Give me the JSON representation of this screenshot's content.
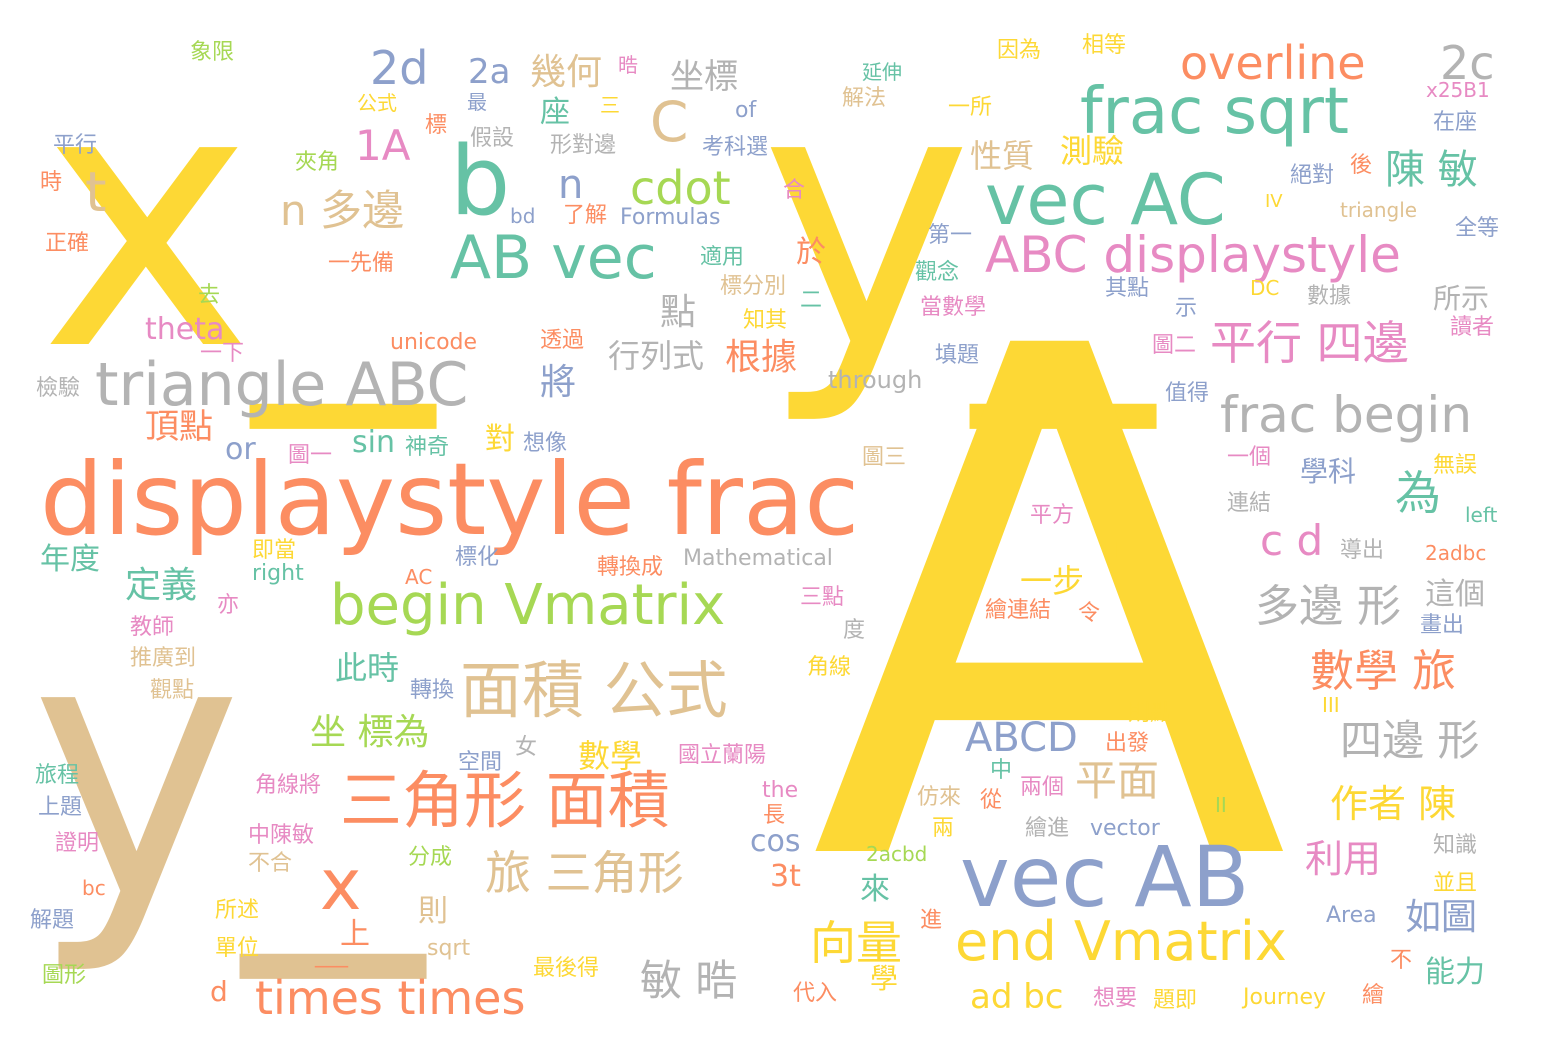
{
  "palette": {
    "yellow": "#fdd835",
    "tan": "#e0c292",
    "green": "#66c2a5",
    "orange": "#fc8d62",
    "blue": "#8da0cb",
    "pink": "#e78ac3",
    "lime": "#a6d854",
    "gray": "#b3b3b3"
  },
  "words": [
    {
      "text": "x_",
      "color": "yellow"
    },
    {
      "text": "y_",
      "color": "yellow"
    },
    {
      "text": "y_",
      "color": "tan"
    },
    {
      "text": "A",
      "color": "yellow"
    },
    {
      "text": "displaystyle frac",
      "color": "orange"
    },
    {
      "text": "vec AB",
      "color": "blue"
    },
    {
      "text": "vec AC",
      "color": "green"
    },
    {
      "text": "frac sqrt",
      "color": "green"
    },
    {
      "text": "AB vec",
      "color": "green"
    },
    {
      "text": "triangle ABC",
      "color": "gray"
    },
    {
      "text": "begin Vmatrix",
      "color": "lime"
    },
    {
      "text": "三角形 面積",
      "color": "orange"
    },
    {
      "text": "面積 公式",
      "color": "tan"
    },
    {
      "text": "end Vmatrix",
      "color": "yellow"
    },
    {
      "text": "ABC displaystyle",
      "color": "pink"
    },
    {
      "text": "frac begin",
      "color": "gray"
    },
    {
      "text": "b",
      "color": "green"
    },
    {
      "text": "x",
      "color": "orange"
    },
    {
      "text": "t",
      "color": "tan"
    },
    {
      "text": "C",
      "color": "tan"
    },
    {
      "text": "overline",
      "color": "orange"
    },
    {
      "text": "2c",
      "color": "gray"
    },
    {
      "text": "2d",
      "color": "blue"
    },
    {
      "text": "2a",
      "color": "blue"
    },
    {
      "text": "幾何",
      "color": "tan"
    },
    {
      "text": "坐標",
      "color": "gray"
    },
    {
      "text": "1A",
      "color": "pink"
    },
    {
      "text": "n",
      "color": "blue"
    },
    {
      "text": "n 多邊",
      "color": "tan"
    },
    {
      "text": "cdot",
      "color": "lime"
    },
    {
      "text": "times times",
      "color": "orange"
    },
    {
      "text": "平行 四邊",
      "color": "pink"
    },
    {
      "text": "陳 敏",
      "color": "green"
    },
    {
      "text": "性質",
      "color": "tan"
    },
    {
      "text": "測驗",
      "color": "yellow"
    },
    {
      "text": "多邊 形",
      "color": "gray"
    },
    {
      "text": "四邊 形",
      "color": "gray"
    },
    {
      "text": "數學 旅",
      "color": "orange"
    },
    {
      "text": "c d",
      "color": "pink"
    },
    {
      "text": "為",
      "color": "green"
    },
    {
      "text": "ABCD",
      "color": "blue"
    },
    {
      "text": "平面",
      "color": "tan"
    },
    {
      "text": "作者 陳",
      "color": "yellow"
    },
    {
      "text": "利用",
      "color": "pink"
    },
    {
      "text": "如圖",
      "color": "blue"
    },
    {
      "text": "能力",
      "color": "green"
    },
    {
      "text": "旅 三角形",
      "color": "tan"
    },
    {
      "text": "向量",
      "color": "yellow"
    },
    {
      "text": "敏 晧",
      "color": "gray"
    },
    {
      "text": "ad bc",
      "color": "yellow"
    },
    {
      "text": "坐 標為",
      "color": "lime"
    },
    {
      "text": "定義",
      "color": "green"
    },
    {
      "text": "此時",
      "color": "green"
    },
    {
      "text": "數學",
      "color": "yellow"
    },
    {
      "text": "根據",
      "color": "orange"
    },
    {
      "text": "將",
      "color": "blue"
    },
    {
      "text": "點",
      "color": "gray"
    },
    {
      "text": "行列式",
      "color": "gray"
    },
    {
      "text": "theta",
      "color": "pink"
    },
    {
      "text": "sin",
      "color": "green"
    },
    {
      "text": "or",
      "color": "blue"
    },
    {
      "text": "頂點",
      "color": "orange"
    },
    {
      "text": "年度",
      "color": "green"
    },
    {
      "text": "一步",
      "color": "yellow"
    },
    {
      "text": "cos",
      "color": "blue"
    },
    {
      "text": "3t",
      "color": "orange"
    },
    {
      "text": "來",
      "color": "green"
    },
    {
      "text": "則",
      "color": "tan"
    },
    {
      "text": "上",
      "color": "orange"
    },
    {
      "text": "d",
      "color": "orange"
    },
    {
      "text": "對",
      "color": "yellow"
    },
    {
      "text": "座",
      "color": "green"
    },
    {
      "text": "於",
      "color": "orange"
    },
    {
      "text": "這個",
      "color": "gray"
    },
    {
      "text": "學科",
      "color": "blue"
    },
    {
      "text": "所示",
      "color": "gray"
    },
    {
      "text": "through",
      "color": "gray"
    },
    {
      "text": "unicode",
      "color": "orange"
    },
    {
      "text": "Formulas",
      "color": "blue"
    },
    {
      "text": "Mathematical",
      "color": "gray"
    },
    {
      "text": "vector",
      "color": "blue"
    },
    {
      "text": "Area",
      "color": "blue"
    },
    {
      "text": "Journey",
      "color": "yellow"
    },
    {
      "text": "triangle",
      "color": "tan"
    },
    {
      "text": "2acbd",
      "color": "lime"
    },
    {
      "text": "2adbc",
      "color": "orange"
    },
    {
      "text": "left",
      "color": "green"
    },
    {
      "text": "right",
      "color": "green"
    },
    {
      "text": "x25B1",
      "color": "pink"
    },
    {
      "text": "of",
      "color": "blue"
    },
    {
      "text": "the",
      "color": "pink"
    },
    {
      "text": "bd",
      "color": "blue"
    },
    {
      "text": "bc",
      "color": "orange"
    },
    {
      "text": "AC",
      "color": "orange"
    },
    {
      "text": "DC",
      "color": "yellow"
    },
    {
      "text": "象限",
      "color": "lime"
    },
    {
      "text": "晧",
      "color": "pink"
    },
    {
      "text": "延伸",
      "color": "green"
    },
    {
      "text": "因為",
      "color": "yellow"
    },
    {
      "text": "相等",
      "color": "yellow"
    },
    {
      "text": "解法",
      "color": "tan"
    },
    {
      "text": "公式",
      "color": "yellow"
    },
    {
      "text": "最",
      "color": "blue"
    },
    {
      "text": "三",
      "color": "yellow"
    },
    {
      "text": "平行",
      "color": "blue"
    },
    {
      "text": "標",
      "color": "orange"
    },
    {
      "text": "假設",
      "color": "gray"
    },
    {
      "text": "形對邊",
      "color": "gray"
    },
    {
      "text": "考科選",
      "color": "blue"
    },
    {
      "text": "一所",
      "color": "yellow"
    },
    {
      "text": "在座",
      "color": "blue"
    },
    {
      "text": "夾角",
      "color": "lime"
    },
    {
      "text": "時",
      "color": "orange"
    },
    {
      "text": "絕對",
      "color": "blue"
    },
    {
      "text": "後",
      "color": "orange"
    },
    {
      "text": "合",
      "color": "pink"
    },
    {
      "text": "了解",
      "color": "orange"
    },
    {
      "text": "第一",
      "color": "blue"
    },
    {
      "text": "全等",
      "color": "blue"
    },
    {
      "text": "正確",
      "color": "orange"
    },
    {
      "text": "一先備",
      "color": "orange"
    },
    {
      "text": "適用",
      "color": "green"
    },
    {
      "text": "觀念",
      "color": "green"
    },
    {
      "text": "其點",
      "color": "blue"
    },
    {
      "text": "數據",
      "color": "gray"
    },
    {
      "text": "去",
      "color": "lime"
    },
    {
      "text": "標分別",
      "color": "tan"
    },
    {
      "text": "二",
      "color": "green"
    },
    {
      "text": "當數學",
      "color": "pink"
    },
    {
      "text": "示",
      "color": "blue"
    },
    {
      "text": "知其",
      "color": "yellow"
    },
    {
      "text": "讀者",
      "color": "pink"
    },
    {
      "text": "一下",
      "color": "pink"
    },
    {
      "text": "透過",
      "color": "orange"
    },
    {
      "text": "填題",
      "color": "blue"
    },
    {
      "text": "圖二",
      "color": "pink"
    },
    {
      "text": "檢驗",
      "color": "gray"
    },
    {
      "text": "值得",
      "color": "blue"
    },
    {
      "text": "神奇",
      "color": "green"
    },
    {
      "text": "想像",
      "color": "blue"
    },
    {
      "text": "圖一",
      "color": "pink"
    },
    {
      "text": "圖三",
      "color": "tan"
    },
    {
      "text": "一個",
      "color": "pink"
    },
    {
      "text": "無誤",
      "color": "yellow"
    },
    {
      "text": "平方",
      "color": "pink"
    },
    {
      "text": "連結",
      "color": "gray"
    },
    {
      "text": "即當",
      "color": "yellow"
    },
    {
      "text": "標化",
      "color": "blue"
    },
    {
      "text": "轉換成",
      "color": "orange"
    },
    {
      "text": "導出",
      "color": "gray"
    },
    {
      "text": "三點",
      "color": "pink"
    },
    {
      "text": "度",
      "color": "gray"
    },
    {
      "text": "亦",
      "color": "pink"
    },
    {
      "text": "教師",
      "color": "pink"
    },
    {
      "text": "繪連結",
      "color": "orange"
    },
    {
      "text": "令",
      "color": "orange"
    },
    {
      "text": "畫出",
      "color": "blue"
    },
    {
      "text": "推廣到",
      "color": "tan"
    },
    {
      "text": "觀點",
      "color": "tan"
    },
    {
      "text": "轉換",
      "color": "blue"
    },
    {
      "text": "角線",
      "color": "yellow"
    },
    {
      "text": "III",
      "color": "yellow"
    },
    {
      "text": "則點",
      "color": "yellow"
    },
    {
      "text": "女",
      "color": "gray"
    },
    {
      "text": "空間",
      "color": "blue"
    },
    {
      "text": "國立蘭陽",
      "color": "pink"
    },
    {
      "text": "出發",
      "color": "orange"
    },
    {
      "text": "旅程",
      "color": "green"
    },
    {
      "text": "中",
      "color": "green"
    },
    {
      "text": "角線將",
      "color": "pink"
    },
    {
      "text": "上題",
      "color": "blue"
    },
    {
      "text": "從",
      "color": "orange"
    },
    {
      "text": "兩個",
      "color": "pink"
    },
    {
      "text": "仿來",
      "color": "tan"
    },
    {
      "text": "II",
      "color": "lime"
    },
    {
      "text": "長",
      "color": "orange"
    },
    {
      "text": "中陳敏",
      "color": "pink"
    },
    {
      "text": "兩",
      "color": "yellow"
    },
    {
      "text": "繪進",
      "color": "gray"
    },
    {
      "text": "證明",
      "color": "pink"
    },
    {
      "text": "不合",
      "color": "tan"
    },
    {
      "text": "分成",
      "color": "lime"
    },
    {
      "text": "知識",
      "color": "gray"
    },
    {
      "text": "並且",
      "color": "yellow"
    },
    {
      "text": "解題",
      "color": "blue"
    },
    {
      "text": "所述",
      "color": "yellow"
    },
    {
      "text": "單位",
      "color": "yellow"
    },
    {
      "text": "進",
      "color": "orange"
    },
    {
      "text": "圖形",
      "color": "lime"
    },
    {
      "text": "sqrt",
      "color": "tan"
    },
    {
      "text": "最後得",
      "color": "yellow"
    },
    {
      "text": "代入",
      "color": "orange"
    },
    {
      "text": "學",
      "color": "yellow"
    },
    {
      "text": "想要",
      "color": "pink"
    },
    {
      "text": "題即",
      "color": "yellow"
    },
    {
      "text": "繪",
      "color": "orange"
    },
    {
      "text": "不",
      "color": "orange"
    },
    {
      "text": "IV",
      "color": "yellow"
    },
    {
      "text": "I",
      "color": "yellow"
    },
    {
      "text": "___",
      "color": "orange"
    }
  ]
}
